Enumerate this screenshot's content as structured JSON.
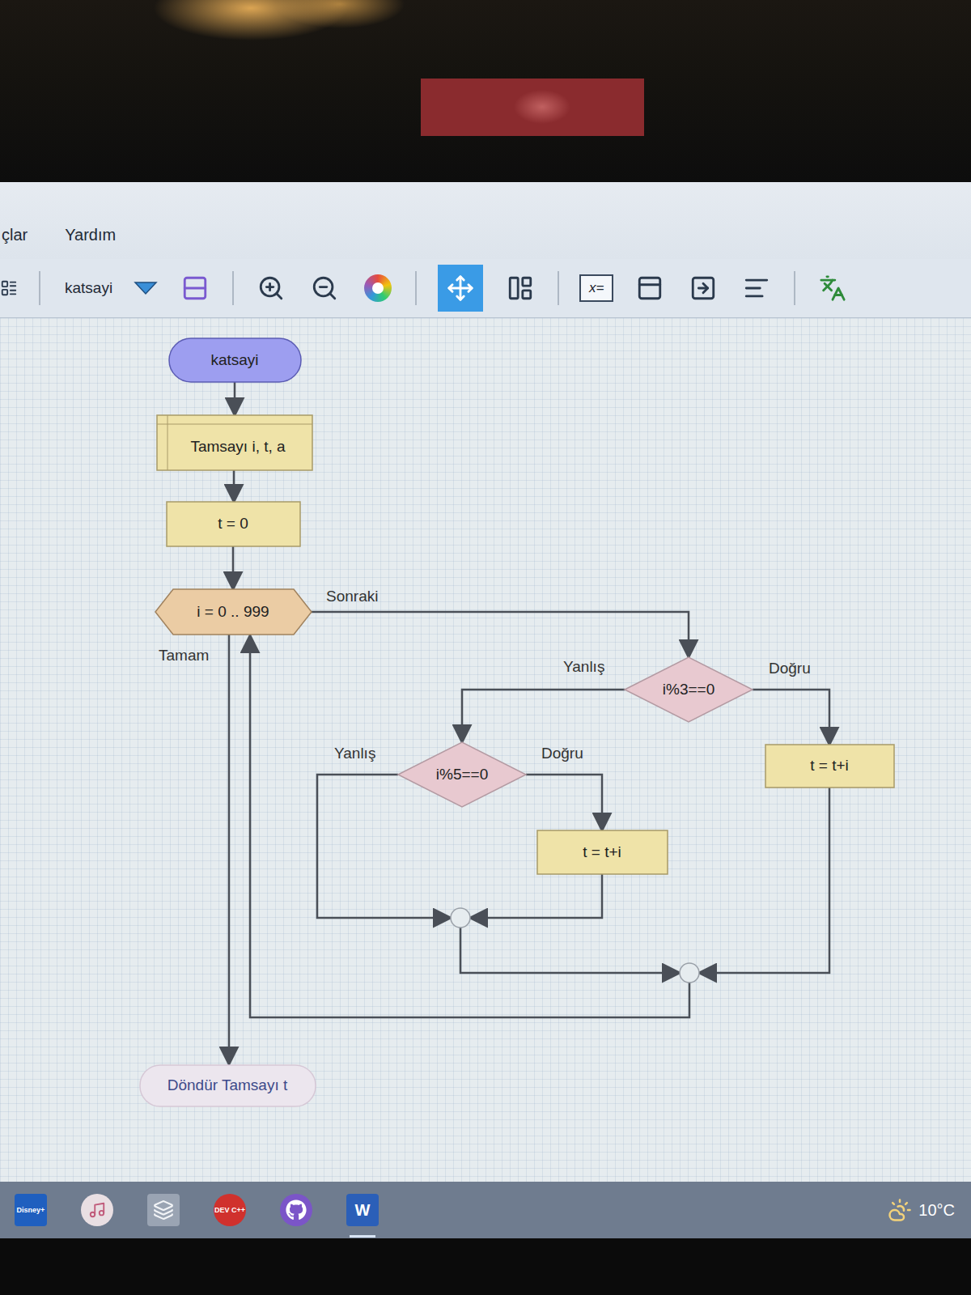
{
  "window": {
    "menu": [
      "çlar",
      "Yardım"
    ]
  },
  "toolbar": {
    "function": "katsayi",
    "buttons": [
      {
        "selected": false
      },
      {
        "selected": false
      },
      {
        "selected": false
      },
      {
        "selected": false
      },
      {
        "selected": true
      },
      {
        "selected": false
      },
      {
        "label": "x=",
        "selected": false
      },
      {
        "selected": false
      },
      {
        "selected": false
      },
      {
        "selected": false
      },
      {
        "selected": false
      }
    ]
  },
  "flowchart": {
    "function": "katsayi",
    "declare": "Tamsayı i, t, a",
    "assign": "t = 0",
    "loop": {
      "text": "i = 0 .. 999",
      "next_label": "Sonraki",
      "done_label": "Tamam"
    },
    "outer_if": {
      "condition": "i%3==0",
      "false_label": "Yanlış",
      "true_label": "Doğru",
      "true_assign": "t = t+i"
    },
    "inner_if": {
      "condition": "i%5==0",
      "false_label": "Yanlış",
      "true_label": "Doğru",
      "true_assign": "t = t+i"
    },
    "return": "Döndür Tamsayı t"
  },
  "taskbar": {
    "apps": [
      {
        "label": "Disney+",
        "selected": false
      },
      {
        "selected": false
      },
      {
        "selected": false
      },
      {
        "label": "DEV C++",
        "selected": false
      },
      {
        "selected": false
      },
      {
        "label": "W",
        "selected": true
      }
    ],
    "weather": "10°C"
  }
}
